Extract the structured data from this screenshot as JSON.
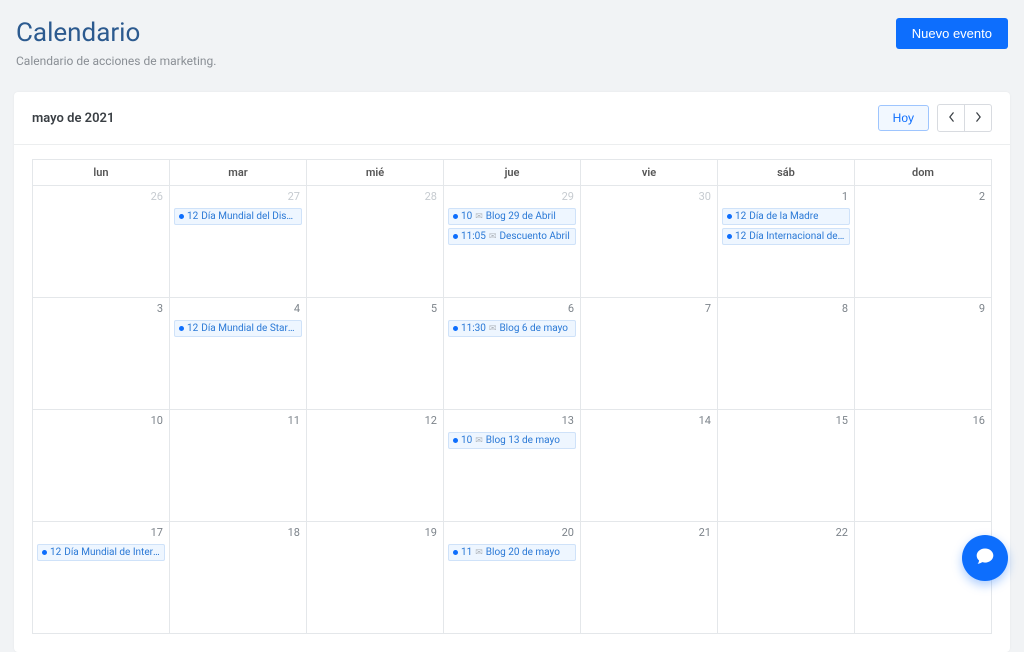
{
  "header": {
    "title": "Calendario",
    "subtitle": "Calendario de acciones de marketing.",
    "new_event_label": "Nuevo evento"
  },
  "calendar": {
    "period_label": "mayo de 2021",
    "today_label": "Hoy",
    "weekdays": [
      "lun",
      "mar",
      "mié",
      "jue",
      "vie",
      "sáb",
      "dom"
    ],
    "weeks": [
      [
        {
          "day": "26",
          "otherMonth": true
        },
        {
          "day": "27",
          "otherMonth": true,
          "events": [
            {
              "time": "12",
              "title": "Día Mundial del Diseño Grá"
            }
          ]
        },
        {
          "day": "28",
          "otherMonth": true
        },
        {
          "day": "29",
          "otherMonth": true,
          "events": [
            {
              "time": "10",
              "mail": true,
              "title": "Blog 29 de Abril"
            },
            {
              "time": "11:05",
              "mail": true,
              "title": "Descuento Abril"
            }
          ]
        },
        {
          "day": "30",
          "otherMonth": true
        },
        {
          "day": "1",
          "events": [
            {
              "time": "12",
              "title": "Día de la Madre"
            },
            {
              "time": "12",
              "title": "Día Internacional de los Tra"
            }
          ]
        },
        {
          "day": "2"
        }
      ],
      [
        {
          "day": "3"
        },
        {
          "day": "4",
          "events": [
            {
              "time": "12",
              "title": "Día Mundial de Star Wars"
            }
          ]
        },
        {
          "day": "5"
        },
        {
          "day": "6",
          "events": [
            {
              "time": "11:30",
              "mail": true,
              "title": "Blog 6 de mayo"
            }
          ]
        },
        {
          "day": "7"
        },
        {
          "day": "8"
        },
        {
          "day": "9"
        }
      ],
      [
        {
          "day": "10"
        },
        {
          "day": "11"
        },
        {
          "day": "12"
        },
        {
          "day": "13",
          "events": [
            {
              "time": "10",
              "mail": true,
              "title": "Blog 13 de mayo"
            }
          ]
        },
        {
          "day": "14"
        },
        {
          "day": "15"
        },
        {
          "day": "16"
        }
      ],
      [
        {
          "day": "17",
          "events": [
            {
              "time": "12",
              "title": "Día Mundial de Internet"
            }
          ]
        },
        {
          "day": "18"
        },
        {
          "day": "19"
        },
        {
          "day": "20",
          "events": [
            {
              "time": "11",
              "mail": true,
              "title": "Blog 20 de mayo"
            }
          ]
        },
        {
          "day": "21"
        },
        {
          "day": "22"
        },
        {
          "day": ""
        }
      ]
    ]
  }
}
